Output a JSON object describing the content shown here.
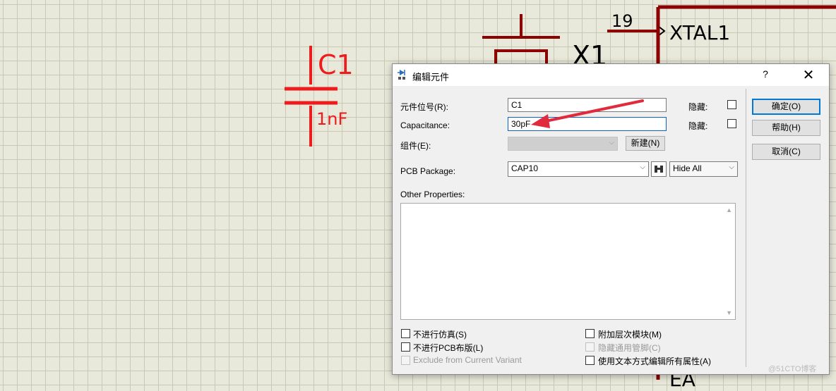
{
  "schematic": {
    "cap_ref": "C1",
    "cap_value": "1nF",
    "crystal_ref": "X1",
    "pin_number": "19",
    "pin_name": "XTAL1",
    "partial_text": "EA"
  },
  "dialog": {
    "title": "编辑元件",
    "help": "?",
    "close": "✕",
    "part_ref_label": "元件位号(R):",
    "part_ref_value": "C1",
    "capacitance_label": "Capacitance:",
    "capacitance_value": "30pF",
    "element_label": "组件(E):",
    "element_value": "",
    "new_button": "新建(N)",
    "hidden_label_1": "隐藏:",
    "hidden_label_2": "隐藏:",
    "pcb_label": "PCB Package:",
    "pcb_value": "CAP10",
    "hide_all_value": "Hide All",
    "other_props_label": "Other Properties:",
    "ok_button": "确定(O)",
    "help_button": "帮助(H)",
    "cancel_button": "取消(C)",
    "checks": {
      "no_sim": "不进行仿真(S)",
      "no_pcb": "不进行PCB布版(L)",
      "exclude_variant": "Exclude from Current Variant",
      "attach_hier": "附加层次模块(M)",
      "hide_pins": "隐藏通用管脚(C)",
      "edit_text": "使用文本方式编辑所有属性(A)"
    }
  },
  "watermark": "@51CTO博客",
  "colors": {
    "schematic_red": "#ee1c1c",
    "component_dark_red": "#8b0000",
    "annotation_arrow": "#e02b3c",
    "focus_blue": "#0078d7"
  }
}
